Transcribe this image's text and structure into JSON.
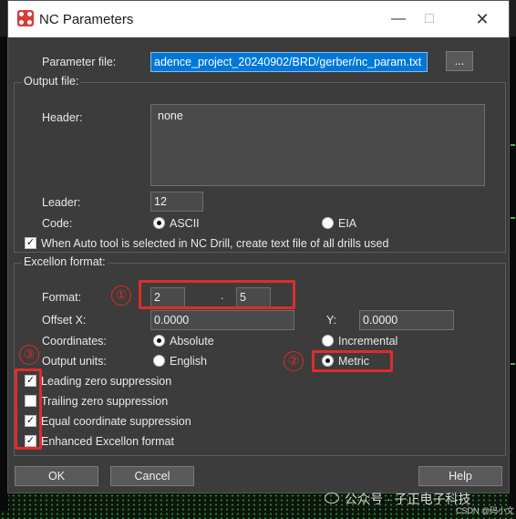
{
  "window": {
    "title": "NC Parameters"
  },
  "parameter_file": {
    "label": "Parameter file:",
    "value": "adence_project_20240902/BRD/gerber/nc_param.txt",
    "browse_label": "..."
  },
  "output_file": {
    "group_title": "Output file:",
    "header_label": "Header:",
    "header_value": "none",
    "leader_label": "Leader:",
    "leader_value": "12",
    "code_label": "Code:",
    "ascii_label": "ASCII",
    "eia_label": "EIA",
    "code_selected": "ASCII",
    "auto_tool_label": "When Auto tool is selected in NC Drill, create text file of all drills used",
    "auto_tool_checked": true
  },
  "excellon": {
    "group_title": "Excellon format:",
    "format_label": "Format:",
    "format_int": "2",
    "format_sep": ".",
    "format_dec": "5",
    "offset_x_label": "Offset X:",
    "offset_x": "0.0000",
    "offset_y_label": "Y:",
    "offset_y": "0.0000",
    "coordinates_label": "Coordinates:",
    "absolute_label": "Absolute",
    "incremental_label": "Incremental",
    "coordinates_selected": "Absolute",
    "output_units_label": "Output units:",
    "english_label": "English",
    "metric_label": "Metric",
    "units_selected": "Metric",
    "options": [
      {
        "label": "Leading zero suppression",
        "checked": true
      },
      {
        "label": "Trailing zero suppression",
        "checked": false
      },
      {
        "label": "Equal coordinate suppression",
        "checked": true
      },
      {
        "label": "Enhanced Excellon format",
        "checked": true
      }
    ]
  },
  "buttons": {
    "ok": "OK",
    "cancel": "Cancel",
    "help": "Help"
  },
  "annotations": {
    "one": "①",
    "two": "②",
    "three": "③",
    "color": "#e02b2b"
  },
  "watermark": {
    "text": "公众号 · 子正电子科技",
    "credit": "CSDN @码小文"
  },
  "icons": {
    "app": "app-icon",
    "minimize": "minimize-icon",
    "maximize": "maximize-icon",
    "close": "close-icon",
    "checkmark": "checkmark-icon",
    "wechat": "wechat-icon"
  }
}
